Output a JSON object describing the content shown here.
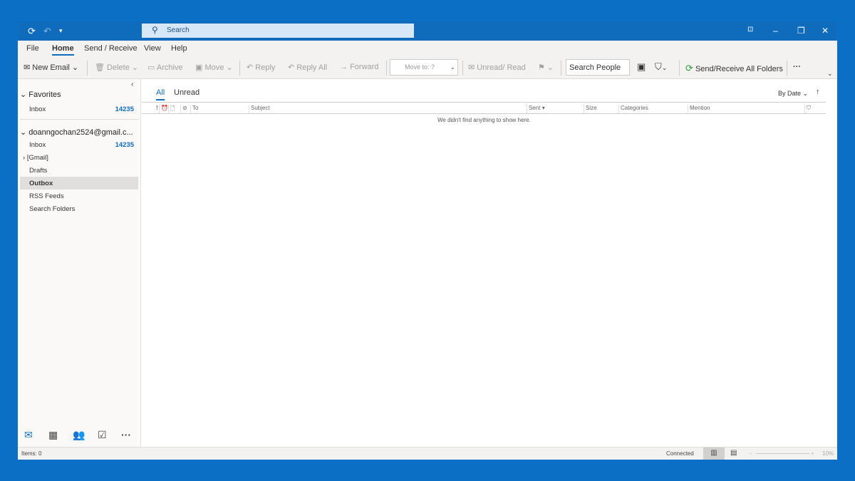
{
  "titlebar": {
    "search_placeholder": "Search"
  },
  "menu": [
    "File",
    "Home",
    "Send / Receive",
    "View",
    "Help"
  ],
  "ribbon": {
    "new_email": "New Email",
    "delete": "Delete",
    "archive": "Archive",
    "move": "Move",
    "reply": "Reply",
    "reply_all": "Reply All",
    "forward": "Forward",
    "move_to": "Move to: ?",
    "unread_read": "Unread/ Read",
    "search_people": "Search People",
    "send_receive_all": "Send/Receive All Folders",
    "more": "···"
  },
  "sidebar": {
    "favorites": "Favorites",
    "fav_inbox": "Inbox",
    "fav_inbox_count": "14235",
    "account": "doanngochan2524@gmail.c...",
    "folders": [
      {
        "label": "Inbox",
        "count": "14235"
      },
      {
        "label": "[Gmail]"
      },
      {
        "label": "Drafts"
      },
      {
        "label": "Outbox"
      },
      {
        "label": "RSS Feeds"
      },
      {
        "label": "Search Folders"
      }
    ]
  },
  "main": {
    "tab_all": "All",
    "tab_unread": "Unread",
    "sort": "By Date",
    "columns": {
      "importance": "!",
      "to": "To",
      "subject": "Subject",
      "sent": "Sent",
      "size": "Size",
      "categories": "Categories",
      "mention": "Mention"
    },
    "empty": "We didn't find anything to show here."
  },
  "status": {
    "items": "Items: 0",
    "connected": "Connected",
    "zoom": "10%"
  }
}
